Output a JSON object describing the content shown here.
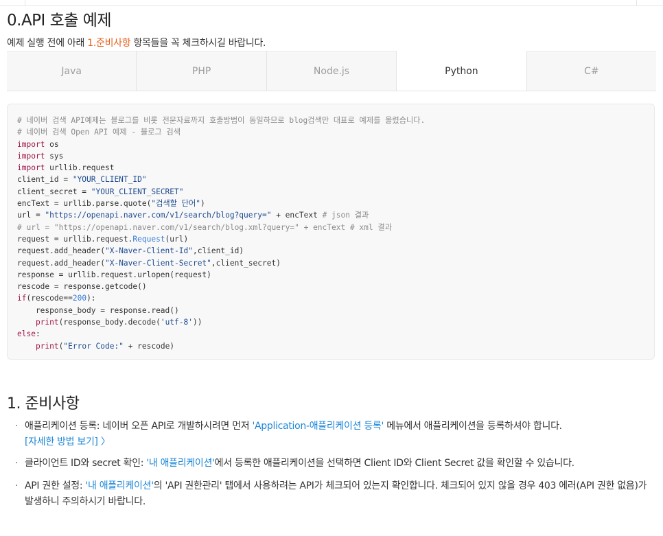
{
  "title": "0.API 호출 예제",
  "intro": {
    "before": "예제 실행 전에 아래 ",
    "highlight": "1.준비사항",
    "after": " 항목들을 꼭 체크하시길 바랍니다."
  },
  "tabs": [
    "Java",
    "PHP",
    "Node.js",
    "Python",
    "C#"
  ],
  "active_tab": "Python",
  "code": {
    "comment1": "# 네이버 검색 API예제는 블로그를 비롯 전문자료까지 호출방법이 동일하므로 blog검색만 대표로 예제를 올렸습니다.",
    "comment2": "# 네이버 검색 Open API 예제 - 블로그 검색",
    "kw_import": "import",
    "mod_os": " os",
    "mod_sys": " sys",
    "mod_urllib": " urllib.request",
    "client_id_lhs": "client_id = ",
    "client_id_val": "\"YOUR_CLIENT_ID\"",
    "client_secret_lhs": "client_secret = ",
    "client_secret_val": "\"YOUR_CLIENT_SECRET\"",
    "enc_lhs": "encText = urllib.parse.quote(",
    "enc_val": "\"검색할 단어\"",
    "enc_end": ")",
    "url_lhs": "url = ",
    "url_val": "\"https://openapi.naver.com/v1/search/blog?query=\"",
    "url_rest": " + encText ",
    "url_cm": "# json 결과",
    "url_xml_cm": "# url = \"https://openapi.naver.com/v1/search/blog.xml?query=\" + encText # xml 결과",
    "req_lhs": "request = urllib.request.",
    "req_fn": "Request",
    "req_end": "(url)",
    "hdr1_lhs": "request.add_header(",
    "hdr1_val": "\"X-Naver-Client-Id\"",
    "hdr1_end": ",client_id)",
    "hdr2_lhs": "request.add_header(",
    "hdr2_val": "\"X-Naver-Client-Secret\"",
    "hdr2_end": ",client_secret)",
    "resp_line": "response = urllib.request.urlopen(request)",
    "rescode_line": "rescode = response.getcode()",
    "kw_if": "if",
    "if_mid": "(rescode==",
    "if_num": "200",
    "if_end": "):",
    "body_line": "    response_body = response.read()",
    "print1_indent": "    ",
    "kw_print": "print",
    "print1_a": "(response_body.decode(",
    "print1_val": "'utf-8'",
    "print1_b": "))",
    "kw_else": "else",
    "else_end": ":",
    "print2_indent": "    ",
    "print2_a": "(",
    "print2_val": "\"Error Code:\"",
    "print2_b": " + rescode)"
  },
  "prep": {
    "title": "1. 준비사항",
    "items": [
      {
        "before": "애플리케이션 등록: 네이버 오픈 API로 개발하시려면 먼저 ",
        "link": "'Application-애플리케이션 등록'",
        "after": " 메뉴에서 애플리케이션을 등록하셔야 합니다.",
        "detail": "[자세한 방법 보기] 〉"
      },
      {
        "before": "클라이언트 ID와 secret 확인: ",
        "link": "'내 애플리케이션'",
        "after": "에서 등록한 애플리케이션을 선택하면 Client ID와 Client Secret 값을 확인할 수 있습니다."
      },
      {
        "before": "API 권한 설정: ",
        "link": "'내 애플리케이션'",
        "after": "의 'API 권한관리' 탭에서 사용하려는 API가 체크되어 있는지 확인합니다. 체크되어 있지 않을 경우 403 에러(API 권한 없음)가 발생하니 주의하시기 바랍니다."
      }
    ]
  },
  "colors": {
    "highlight": "#e8601d",
    "link": "#1b86d8",
    "code_keyword": "#a0174a",
    "code_string": "#1d4b8f",
    "code_comment": "#8a8a8a"
  }
}
